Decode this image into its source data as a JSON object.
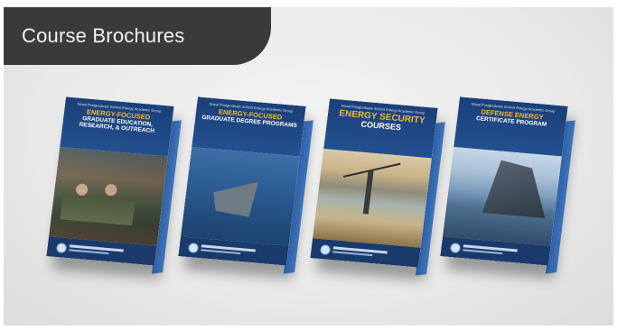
{
  "header": {
    "title": "Course Brochures"
  },
  "brochures": [
    {
      "org": "Naval Postgraduate School Energy Academic Group",
      "headline": "ENERGY-FOCUSED",
      "subtitle": "GRADUATE EDUCATION, RESEARCH, & OUTREACH",
      "footer": "ENERGY ACADEMIC GROUP"
    },
    {
      "org": "Naval Postgraduate School Energy Academic Group",
      "headline": "ENERGY-FOCUSED",
      "subtitle": "GRADUATE DEGREE PROGRAMS",
      "footer": "ENERGY ACADEMIC GROUP"
    },
    {
      "org": "Naval Postgraduate School Energy Academic Group",
      "headline": "ENERGY SECURITY",
      "subtitle": "COURSES",
      "footer": "ENERGY ACADEMIC GROUP"
    },
    {
      "org": "Naval Postgraduate School Energy Academic Group",
      "headline": "DEFENSE ENERGY",
      "subtitle": "CERTIFICATE PROGRAM",
      "footer": "ENERGY ACADEMIC GROUP"
    }
  ]
}
